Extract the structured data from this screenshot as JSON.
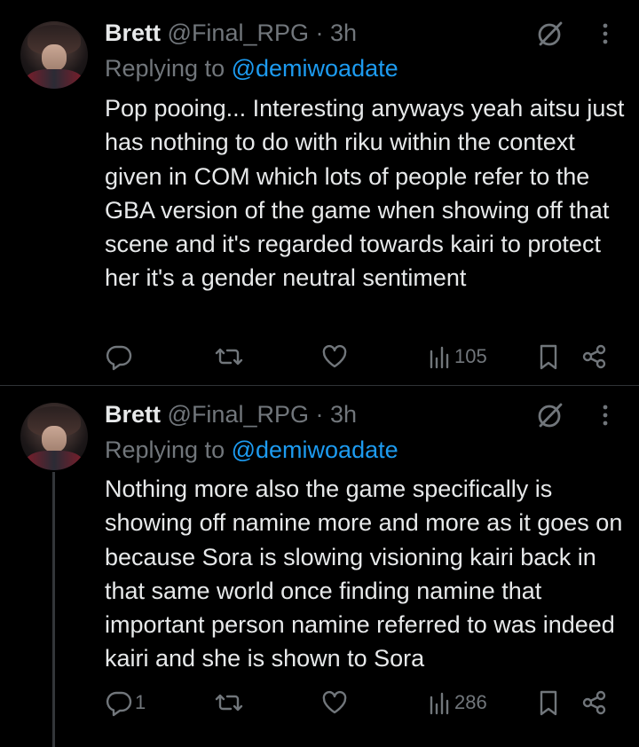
{
  "tweets": [
    {
      "name": "Brett",
      "handle": "@Final_RPG",
      "separator": "·",
      "time": "3h",
      "replying_label": "Replying to",
      "replying_to": "@demiwoadate",
      "text": "Pop pooing... Interesting anyways yeah aitsu just has nothing to do with riku within the context given in COM which lots of people refer to the GBA version of the game when showing off that scene and it's regarded towards kairi to protect her it's a gender neutral sentiment",
      "reply_count": "",
      "views": "105"
    },
    {
      "name": "Brett",
      "handle": "@Final_RPG",
      "separator": "·",
      "time": "3h",
      "replying_label": "Replying to",
      "replying_to": "@demiwoadate",
      "text": "Nothing more also the game specifically is showing off namine more and more as it goes on because Sora is slowing visioning kairi back in that same world once finding namine that important person namine referred to was indeed kairi and she is shown to Sora",
      "reply_count": "1",
      "views": "286"
    }
  ],
  "icons": {
    "grok": "grok-icon",
    "more": "more-icon",
    "reply": "reply-icon",
    "retweet": "retweet-icon",
    "like": "like-icon",
    "views": "views-icon",
    "bookmark": "bookmark-icon",
    "share": "share-icon"
  },
  "colors": {
    "background": "#000000",
    "text": "#e7e9ea",
    "muted": "#71767b",
    "link": "#1d9bf0",
    "divider": "#2f3336"
  }
}
